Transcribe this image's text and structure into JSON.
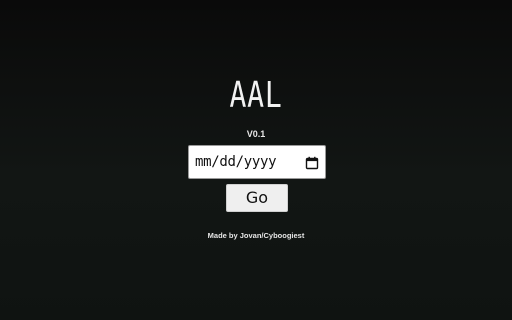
{
  "app": {
    "title": "AAL",
    "version": "V0.1",
    "credit": "Made by Jovan/Cyboogiest"
  },
  "form": {
    "date_placeholder": "mm/dd/yyyy",
    "date_value": "",
    "calendar_icon": "calendar-icon",
    "go_label": "Go"
  },
  "colors": {
    "background": "#0f1311",
    "text": "#f2f2f2",
    "button_bg": "#efefef"
  }
}
